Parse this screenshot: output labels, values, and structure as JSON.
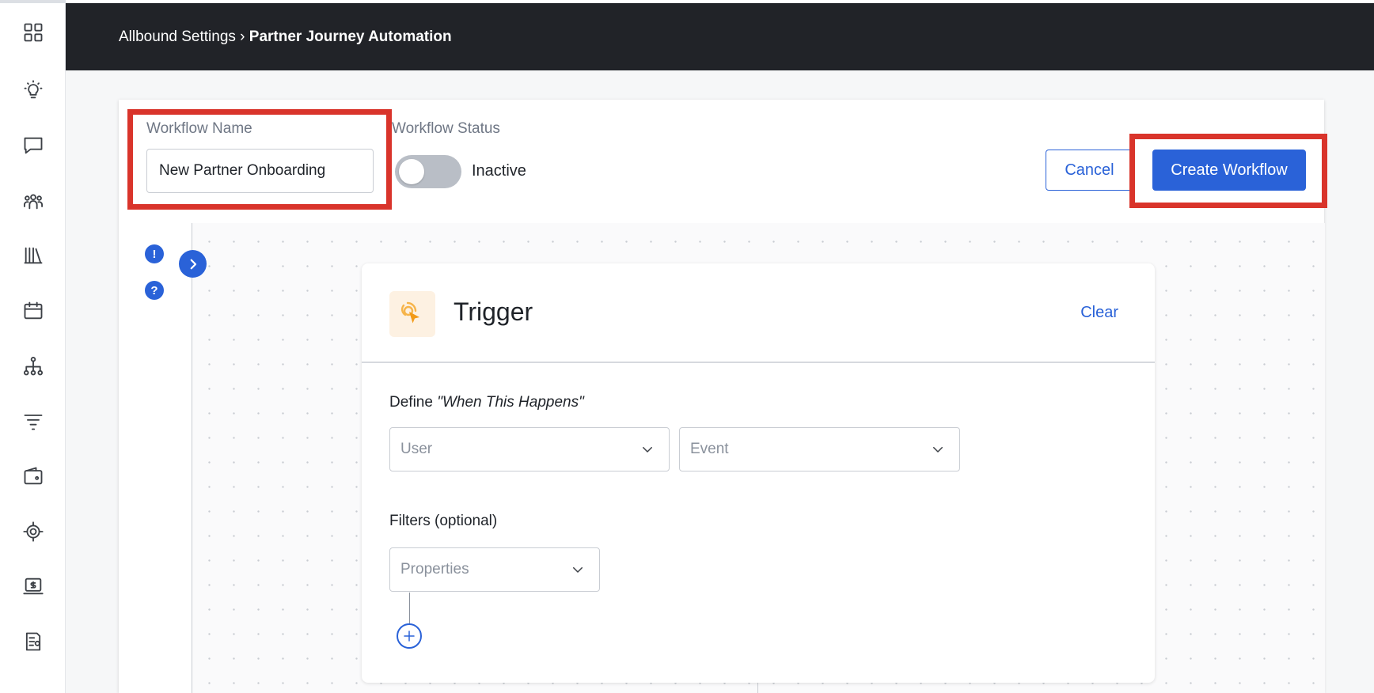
{
  "breadcrumb": {
    "parent": "Allbound Settings",
    "separator": "›",
    "current": "Partner Journey Automation"
  },
  "sidebar": {
    "icons": [
      "dashboard-icon",
      "lightbulb-icon",
      "chat-icon",
      "users-icon",
      "library-icon",
      "calendar-icon",
      "org-chart-icon",
      "filter-icon",
      "wallet-icon",
      "target-icon",
      "payment-icon",
      "report-icon"
    ]
  },
  "workflow": {
    "name_label": "Workflow Name",
    "name_value": "New Partner Onboarding",
    "status_label": "Workflow Status",
    "status_value": "Inactive",
    "cancel_label": "Cancel",
    "create_label": "Create Workflow"
  },
  "canvas": {
    "alert_badge": "!",
    "help_badge": "?"
  },
  "trigger": {
    "title": "Trigger",
    "clear_label": "Clear",
    "define_prefix": "Define",
    "define_emphasis": "\"When This Happens\"",
    "user_placeholder": "User",
    "event_placeholder": "Event",
    "filters_label": "Filters (optional)",
    "properties_placeholder": "Properties"
  },
  "colors": {
    "accent": "#2a62d8",
    "highlight": "#d9342b",
    "topbar": "#212328"
  }
}
